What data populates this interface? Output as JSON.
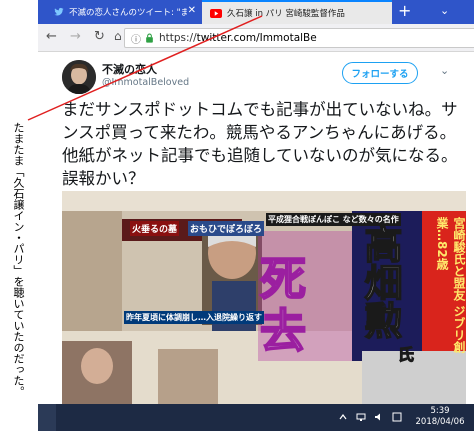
{
  "annotation": {
    "text": "たまたま「久石譲イン・パリ」を聴いていたのだった。"
  },
  "browser": {
    "tabs": [
      {
        "label": "不滅の恋人さんのツイート: \"また",
        "icon": "twitter-bird-icon",
        "active": false
      },
      {
        "label": "久石譲 in パリ  宮崎駿監督作品",
        "icon": "youtube-icon",
        "active": true
      }
    ],
    "new_tab_label": "+",
    "url_scheme": "https://",
    "url_host": "twitter.com/ImmotalBe"
  },
  "tweet": {
    "display_name": "不滅の恋人",
    "handle": "@ImmotalBeloved",
    "follow_label": "フォローする",
    "text": "まだサンスポドットコムでも記事が出ていないね。サンスポ買って来たわ。競馬やるアンちゃんにあげる。他紙がネット記事でも追随していないのが気になる。誤報かい？"
  },
  "newspaper": {
    "headline_1": "死",
    "headline_2": "去",
    "name": "高畑勲",
    "name_suffix": "氏",
    "side_caption": "宮崎駿氏と盟友 ジブリ創業…82歳",
    "top_caption_1": "火垂るの墓",
    "top_caption_2": "おもひでぽろぽろ",
    "top_caption_3": "平成狸合戦ぽんぽこ など数々の名作",
    "sub_caption": "昨年夏頃に体調崩し…入退院繰り返す"
  },
  "taskbar": {
    "time": "5:39",
    "date": "2018/04/06"
  },
  "colors": {
    "tab_bar": "#2f55c9",
    "twitter_blue": "#1da1f2",
    "headline_purple": "#9b1fa0",
    "taskbar": "#1d2a44",
    "annotation_line": "#e02020"
  }
}
